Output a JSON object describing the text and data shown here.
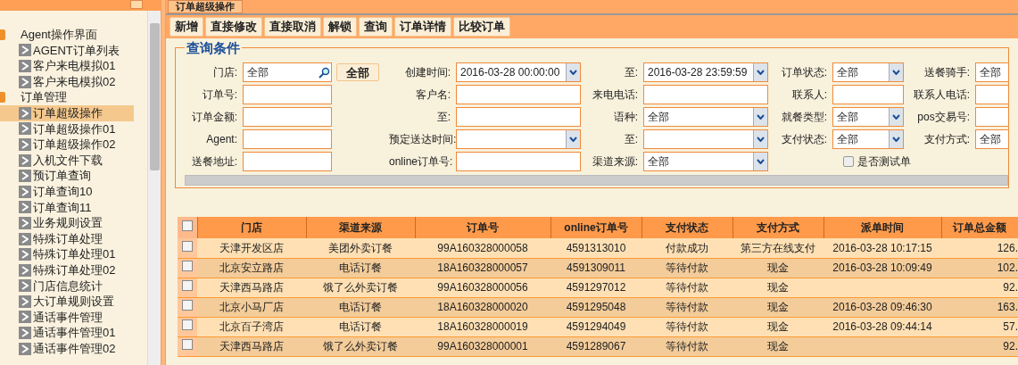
{
  "tab": {
    "label": "订单超级操作"
  },
  "sidebar": {
    "items": [
      {
        "label": "Agent操作界面",
        "expanded": true,
        "children": [
          {
            "label": "AGENT订单列表",
            "selected": false
          },
          {
            "label": "客户来电模拟01",
            "selected": false
          },
          {
            "label": "客户来电模拟02",
            "selected": false
          }
        ]
      },
      {
        "label": "订单管理",
        "expanded": true,
        "children": [
          {
            "label": "订单超级操作",
            "selected": true
          },
          {
            "label": "订单超级操作01",
            "selected": false
          },
          {
            "label": "订单超级操作02",
            "selected": false
          },
          {
            "label": "入机文件下载",
            "selected": false
          },
          {
            "label": "预订单查询",
            "selected": false
          },
          {
            "label": "订单查询10",
            "selected": false
          },
          {
            "label": "订单查询11",
            "selected": false
          },
          {
            "label": "业务规则设置",
            "selected": false
          },
          {
            "label": "特殊订单处理",
            "selected": false
          },
          {
            "label": "特殊订单处理01",
            "selected": false
          },
          {
            "label": "特殊订单处理02",
            "selected": false
          },
          {
            "label": "门店信息统计",
            "selected": false
          },
          {
            "label": "大订单规则设置",
            "selected": false
          },
          {
            "label": "通话事件管理",
            "selected": false
          },
          {
            "label": "通话事件管理01",
            "selected": false
          },
          {
            "label": "通话事件管理02",
            "selected": false
          }
        ]
      }
    ]
  },
  "toolbar": [
    "新增",
    "直接修改",
    "直接取消",
    "解锁",
    "查询",
    "订单详情",
    "比较订单"
  ],
  "query": {
    "title": "查询条件",
    "rows": [
      [
        {
          "label": "门店:",
          "kind": "search",
          "value": "全部",
          "button": "全部"
        },
        {
          "label": "创建时间:",
          "kind": "select",
          "value": "2016-03-28 00:00:00"
        },
        {
          "label": "至:",
          "kind": "select",
          "value": "2016-03-28 23:59:59"
        },
        {
          "label": "订单状态:",
          "kind": "select",
          "value": "全部"
        },
        {
          "label": "送餐骑手:",
          "kind": "text",
          "value": "全部"
        }
      ],
      [
        {
          "label": "订单号:",
          "kind": "text"
        },
        {
          "label": "客户名:",
          "kind": "text"
        },
        {
          "label": "来电电话:",
          "kind": "text"
        },
        {
          "label": "联系人:",
          "kind": "text"
        },
        {
          "label": "联系人电话:",
          "kind": "text"
        }
      ],
      [
        {
          "label": "订单金额:",
          "kind": "text"
        },
        {
          "label": "至:",
          "kind": "text"
        },
        {
          "label": "语种:",
          "kind": "select",
          "value": "全部"
        },
        {
          "label": "就餐类型:",
          "kind": "select",
          "value": "全部"
        },
        {
          "label": "pos交易号:",
          "kind": "text"
        }
      ],
      [
        {
          "label": "Agent:",
          "kind": "text"
        },
        {
          "label": "预定送达时间:",
          "kind": "select"
        },
        {
          "label": "至:",
          "kind": "select"
        },
        {
          "label": "支付状态:",
          "kind": "select",
          "value": "全部"
        },
        {
          "label": "支付方式:",
          "kind": "text",
          "value": "全部"
        }
      ],
      [
        {
          "label": "送餐地址:",
          "kind": "text"
        },
        {
          "label": "online订单号:",
          "kind": "text"
        },
        {
          "label": "渠道来源:",
          "kind": "select",
          "value": "全部"
        },
        {
          "label": "是否测试单",
          "kind": "checkbox",
          "checked": false
        }
      ]
    ]
  },
  "table": {
    "header_checked": false,
    "columns": [
      "门店",
      "渠道来源",
      "订单号",
      "online订单号",
      "支付状态",
      "支付方式",
      "派单时间",
      "订单总金额"
    ],
    "rows": [
      {
        "checked": false,
        "cells": [
          "天津开发区店",
          "美团外卖订餐",
          "99A160328000058",
          "4591313010",
          "付款成功",
          "第三方在线支付",
          "2016-03-28 10:17:15",
          "126."
        ]
      },
      {
        "checked": false,
        "cells": [
          "北京安立路店",
          "电话订餐",
          "18A160328000057",
          "4591309011",
          "等待付款",
          "现金",
          "2016-03-28 10:09:49",
          "102."
        ]
      },
      {
        "checked": false,
        "cells": [
          "天津西马路店",
          "饿了么外卖订餐",
          "99A160328000056",
          "4591297012",
          "等待付款",
          "现金",
          "",
          "92."
        ]
      },
      {
        "checked": false,
        "cells": [
          "北京小马厂店",
          "电话订餐",
          "18A160328000020",
          "4591295048",
          "等待付款",
          "现金",
          "2016-03-28 09:46:30",
          "163."
        ]
      },
      {
        "checked": false,
        "cells": [
          "北京百子湾店",
          "电话订餐",
          "18A160328000019",
          "4591294049",
          "等待付款",
          "现金",
          "2016-03-28 09:44:14",
          "57."
        ]
      },
      {
        "checked": false,
        "cells": [
          "天津西马路店",
          "饿了么外卖订餐",
          "99A160328000001",
          "4591289067",
          "等待付款",
          "现金",
          "",
          "92."
        ]
      }
    ]
  }
}
